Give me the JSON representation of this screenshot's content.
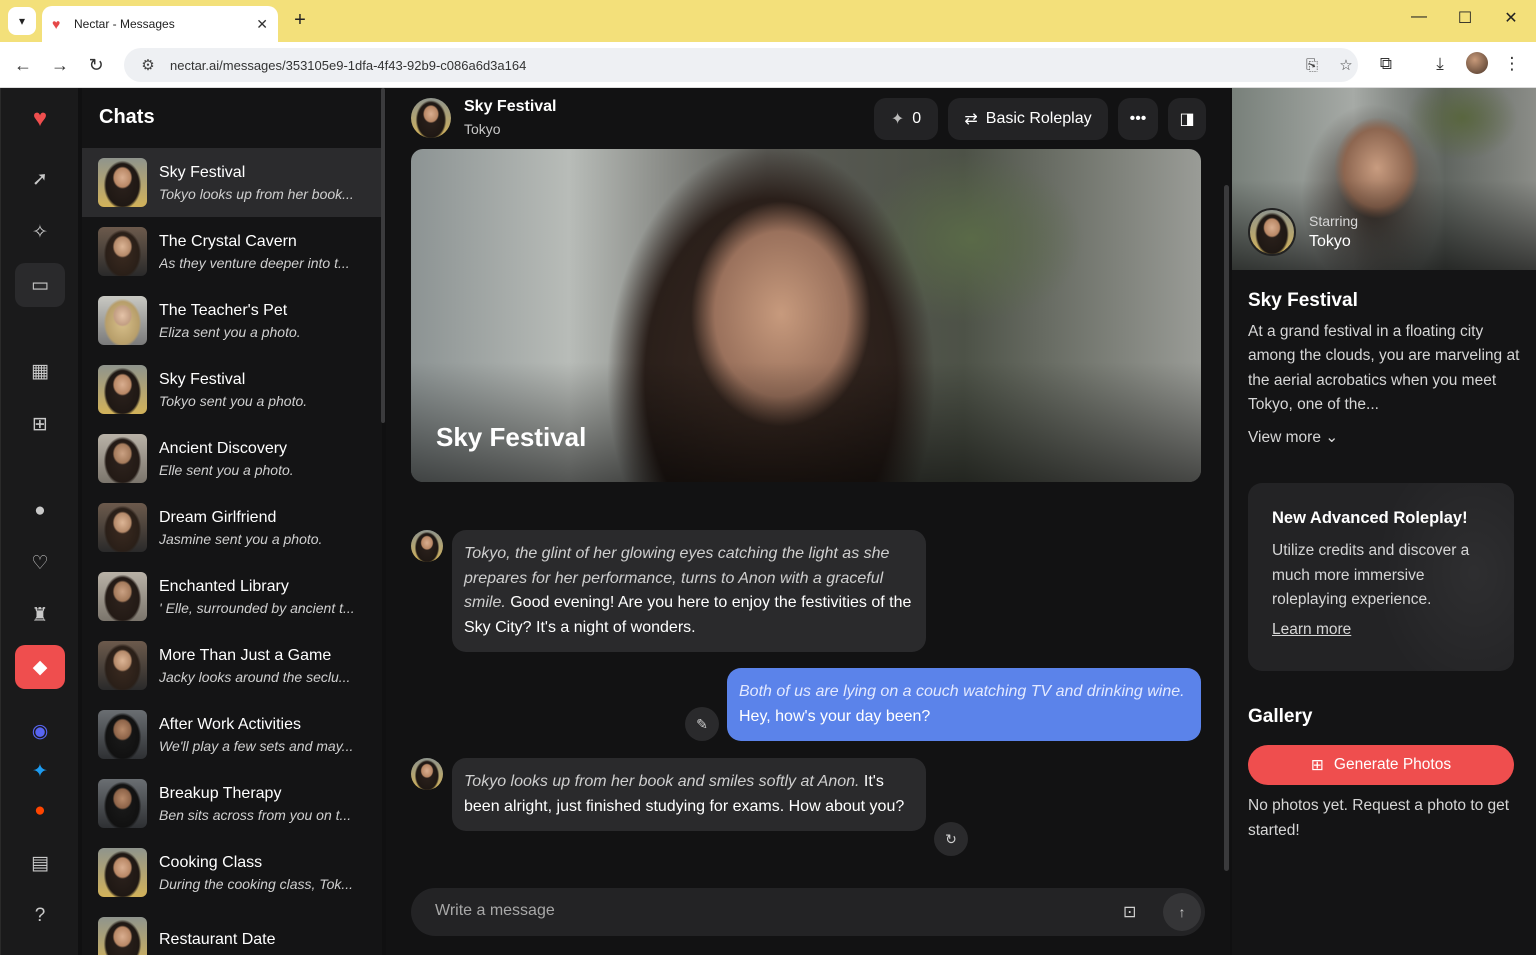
{
  "browser": {
    "tab_title": "Nectar - Messages",
    "url": "nectar.ai/messages/353105e9-1dfa-4f43-92b9-c086a6d3a164",
    "tabbar_color": "#f3e07a"
  },
  "chats": {
    "title": "Chats",
    "items": [
      {
        "name": "Sky Festival",
        "preview": "Tokyo looks up from her book..."
      },
      {
        "name": "The Crystal Cavern",
        "preview": "As they venture deeper into t..."
      },
      {
        "name": "The Teacher's Pet",
        "preview": "Eliza sent you a photo."
      },
      {
        "name": "Sky Festival",
        "preview": "Tokyo sent you a photo."
      },
      {
        "name": "Ancient Discovery",
        "preview": "Elle sent you a photo."
      },
      {
        "name": "Dream Girlfriend",
        "preview": "Jasmine sent you a photo."
      },
      {
        "name": "Enchanted Library",
        "preview": "' Elle, surrounded by ancient t..."
      },
      {
        "name": "More Than Just a Game",
        "preview": "Jacky looks around the seclu..."
      },
      {
        "name": "After Work Activities",
        "preview": "We'll play a few sets and may..."
      },
      {
        "name": "Breakup Therapy",
        "preview": "Ben sits across from you on t..."
      },
      {
        "name": "Cooking Class",
        "preview": "During the cooking class, Tok..."
      },
      {
        "name": "Restaurant Date",
        "preview": ""
      }
    ]
  },
  "conversation": {
    "title": "Sky Festival",
    "character": "Tokyo",
    "credits": "0",
    "mode": "Basic Roleplay",
    "banner_title": "Sky Festival",
    "messages": [
      {
        "role": "bot",
        "narration": "Tokyo, the glint of her glowing eyes catching the light as she prepares for her performance, turns to Anon with a graceful smile.",
        "text": " Good evening! Are you here to enjoy the festivities of the Sky City? It's a night of wonders."
      },
      {
        "role": "user",
        "narration": "Both of us are lying on a couch watching TV and drinking wine.",
        "text": " Hey, how's your day been?"
      },
      {
        "role": "bot",
        "narration": "Tokyo looks up from her book and smiles softly at Anon.",
        "text": " It's been alright, just finished studying for exams. How about you?"
      }
    ],
    "composer_placeholder": "Write a message"
  },
  "sidebar": {
    "starring_label": "Starring",
    "starring_name": "Tokyo",
    "scenario_title": "Sky Festival",
    "scenario_desc": "At a grand festival in a floating city among the clouds, you are marveling at the aerial acrobatics when you meet Tokyo, one of the...",
    "view_more": "View more",
    "promo_title": "New Advanced Roleplay!",
    "promo_body": "Utilize credits and discover a much more immersive roleplaying experience.",
    "promo_link": "Learn more",
    "gallery_title": "Gallery",
    "generate_label": "Generate Photos",
    "gallery_empty": "No photos yet. Request a photo to get started!"
  },
  "colors": {
    "accent": "#ef4e4e",
    "user_bubble": "#5b83ea",
    "bot_bubble": "#2a2a2c"
  }
}
